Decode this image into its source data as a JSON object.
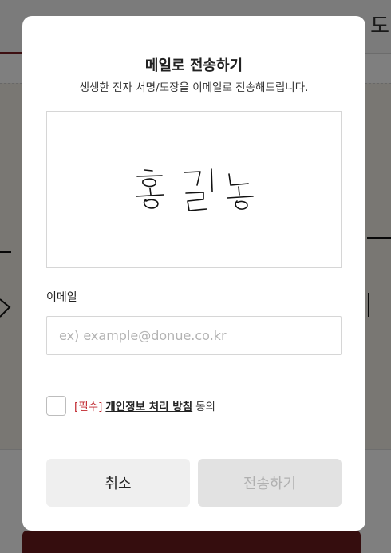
{
  "background": {
    "header_text": "도"
  },
  "modal": {
    "title": "메일로 전송하기",
    "subtitle": "생생한 전자 서명/도장을 이메일로 전송해드립니다.",
    "signature_icon": "signature-preview",
    "email_label": "이메일",
    "email_placeholder": "ex) example@donue.co.kr",
    "email_value": "",
    "agreement": {
      "required": "[필수]",
      "policy_link": "개인정보 처리 방침",
      "suffix": "동의",
      "checked": false
    },
    "cancel_label": "취소",
    "send_label": "전송하기"
  },
  "colors": {
    "required": "#c0262d",
    "send_disabled_bg": "#e2e2e2",
    "brand_dark": "#6b1b1c"
  }
}
